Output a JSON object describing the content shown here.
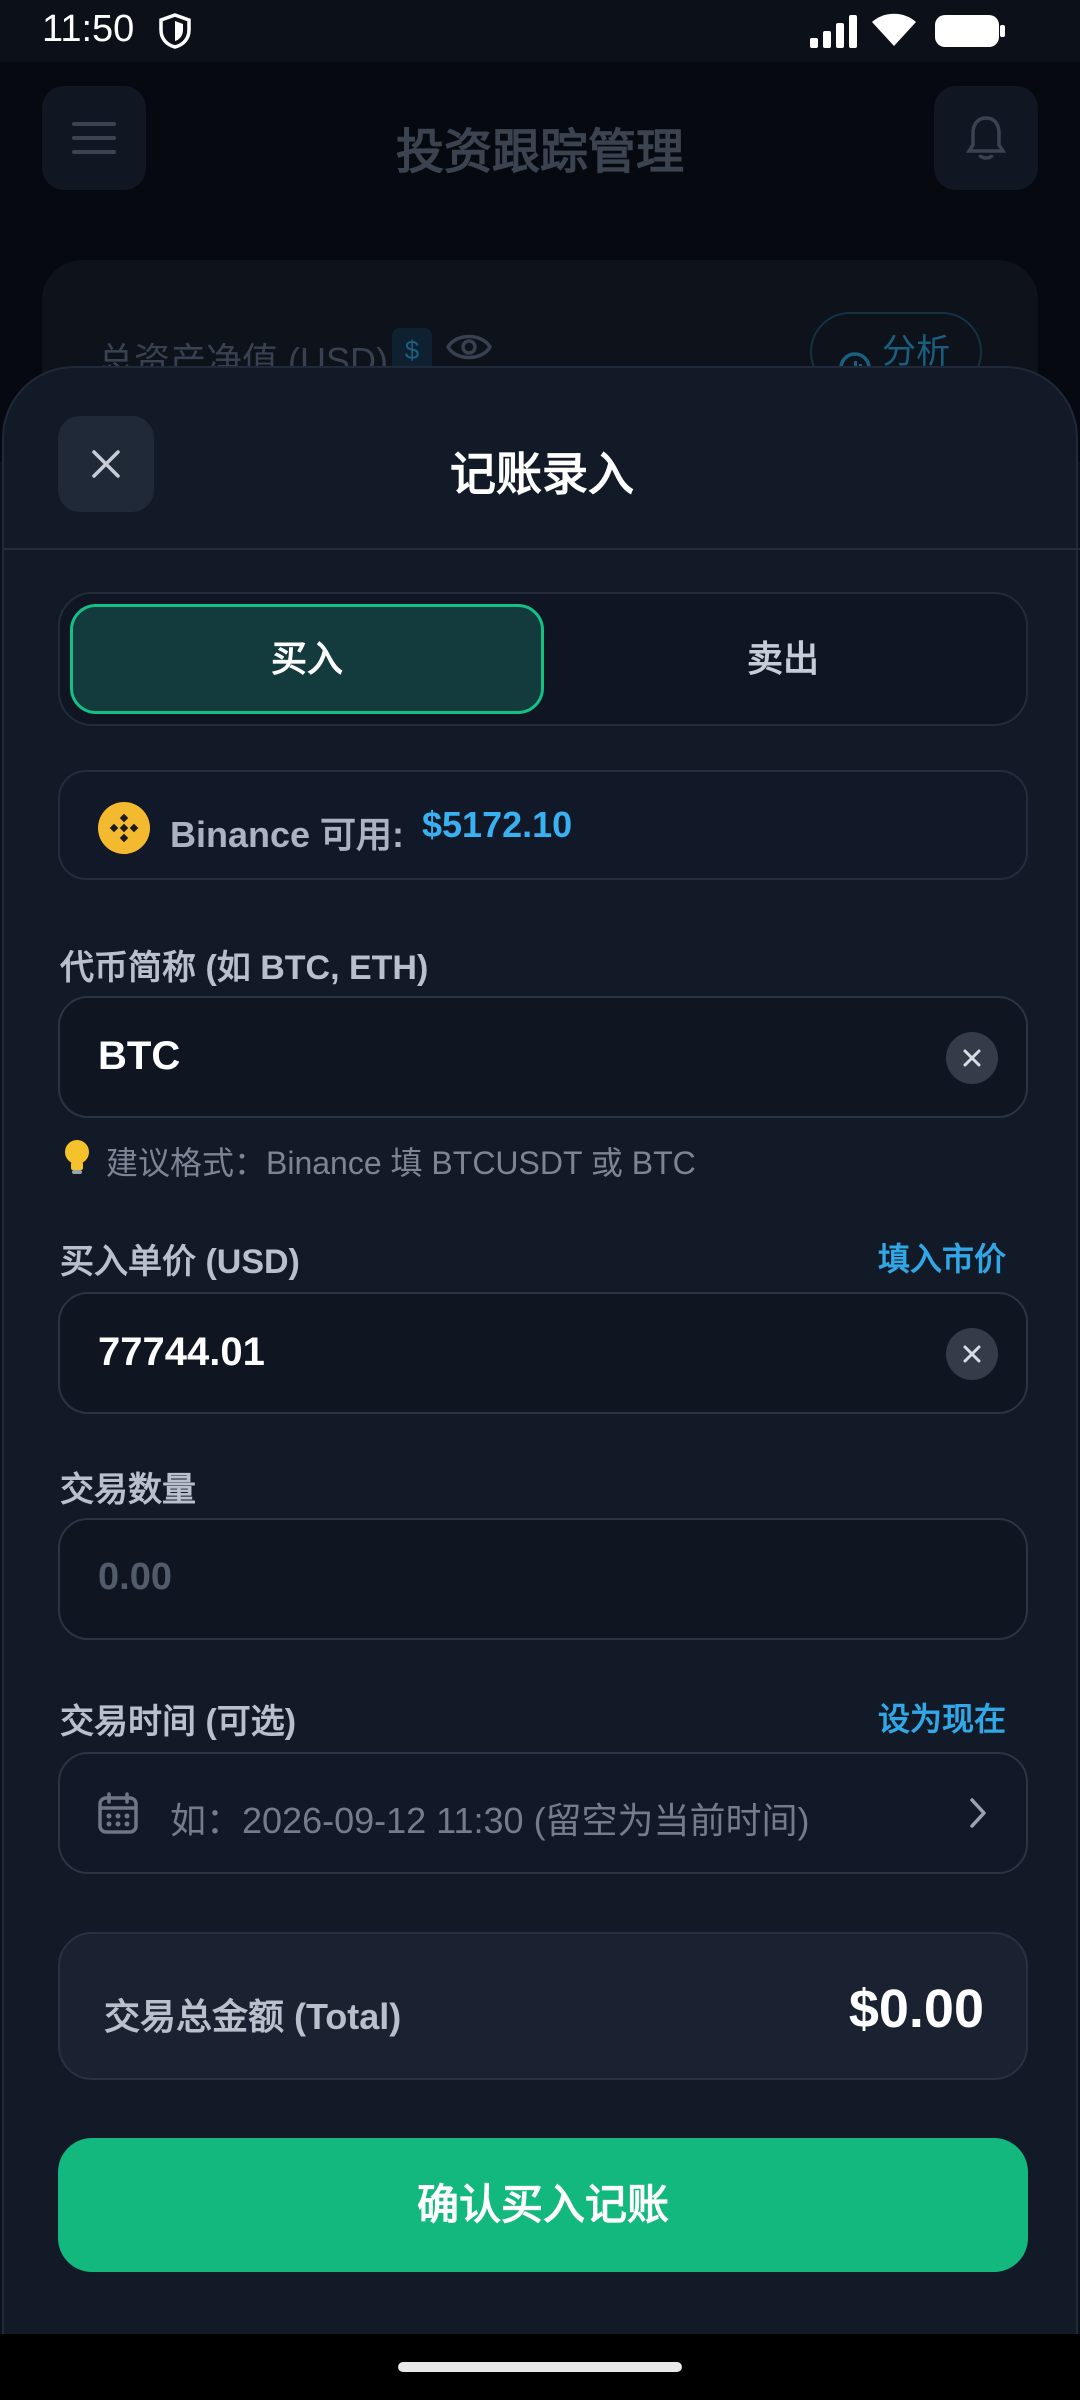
{
  "status_bar": {
    "time": "11:50"
  },
  "background_app": {
    "title": "投资跟踪管理",
    "card_label": "总资产净值 (USD)",
    "currency_symbol": "$",
    "analyze_label": "分析"
  },
  "sheet": {
    "title": "记账录入",
    "tabs": {
      "buy": "买入",
      "sell": "卖出",
      "active": "buy"
    },
    "available": {
      "label": "Binance 可用:",
      "value": "$5172.10"
    },
    "symbol_field": {
      "label": "代币简称 (如 BTC, ETH)",
      "value": "BTC",
      "hint": "建议格式：Binance 填 BTCUSDT 或 BTC"
    },
    "price_field": {
      "label": "买入单价 (USD)",
      "action": "填入市价",
      "value": "77744.01"
    },
    "quantity_field": {
      "label": "交易数量",
      "placeholder": "0.00"
    },
    "time_field": {
      "label": "交易时间 (可选)",
      "action": "设为现在",
      "placeholder": "如：2026-09-12 11:30 (留空为当前时间)"
    },
    "total": {
      "label": "交易总金额 (Total)",
      "value": "$0.00"
    },
    "confirm_label": "确认买入记账"
  },
  "colors": {
    "accent_green": "#12b87d",
    "accent_blue": "#32a7e6",
    "binance_yellow": "#f3ba2f",
    "sheet_bg": "#121a28"
  }
}
